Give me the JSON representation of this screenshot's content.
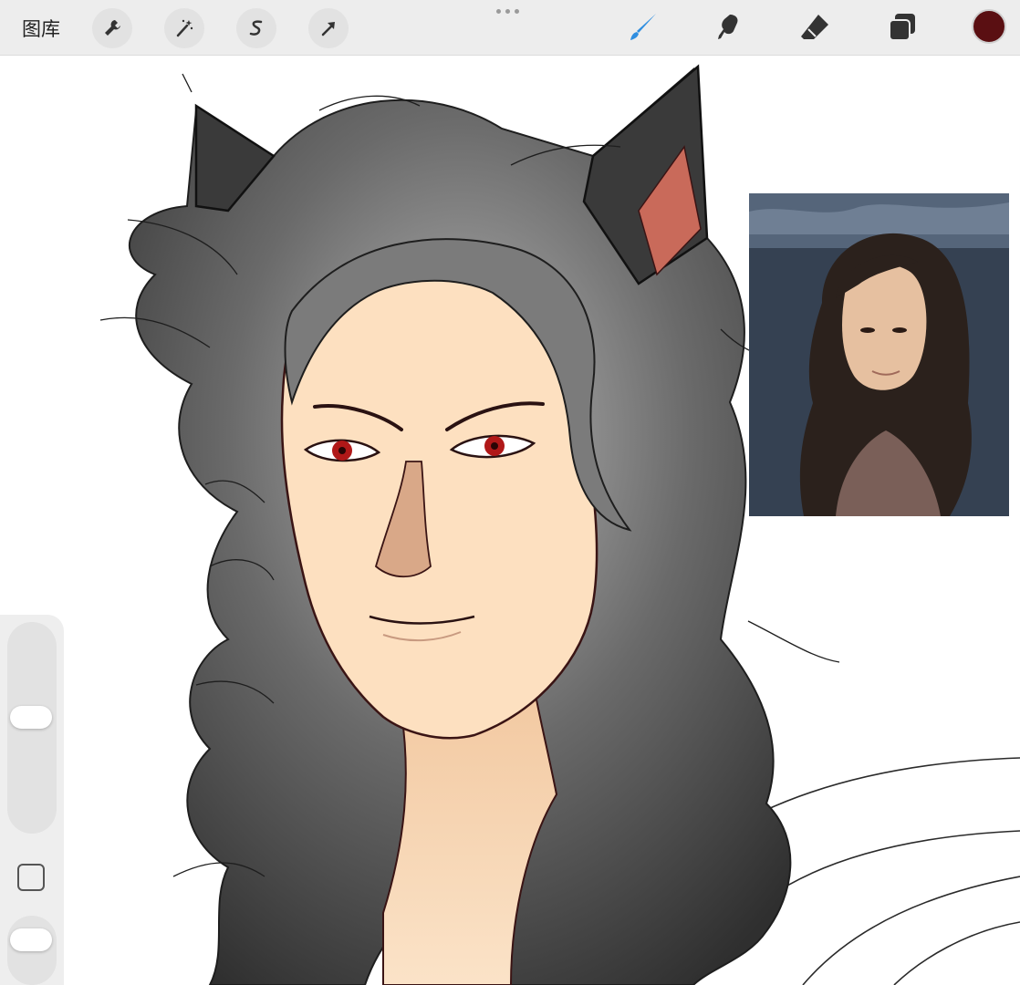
{
  "toolbar": {
    "gallery_label": "图库",
    "left_tools": [
      {
        "name": "actions",
        "icon": "wrench-icon"
      },
      {
        "name": "adjustments",
        "icon": "magic-wand-icon"
      },
      {
        "name": "selection",
        "icon": "selection-s-icon"
      },
      {
        "name": "transform",
        "icon": "arrow-cursor-icon"
      }
    ],
    "more_icon": "ellipsis-icon",
    "right_tools": [
      {
        "name": "brush",
        "icon": "brush-icon",
        "active": true
      },
      {
        "name": "smudge",
        "icon": "smudge-icon",
        "active": false
      },
      {
        "name": "eraser",
        "icon": "eraser-icon",
        "active": false
      },
      {
        "name": "layers",
        "icon": "layers-icon",
        "active": false
      }
    ],
    "current_color": "#5a0f12",
    "active_tool_color": "#2f8ee0"
  },
  "sidebar": {
    "brush_size_icon": "brush-size-slider",
    "modify_icon": "square-modify-icon",
    "opacity_icon": "brush-opacity-slider"
  },
  "canvas": {
    "artwork": "cat-eared-portrait-sketch",
    "reference": "reference-photo"
  },
  "colors": {
    "skin": "#fde0c0",
    "hair_dark": "#2e2e2e",
    "hair_light": "#9a9a9a",
    "eye": "#b01818",
    "ear_inner": "#c96a5a",
    "line": "#3a1414"
  }
}
